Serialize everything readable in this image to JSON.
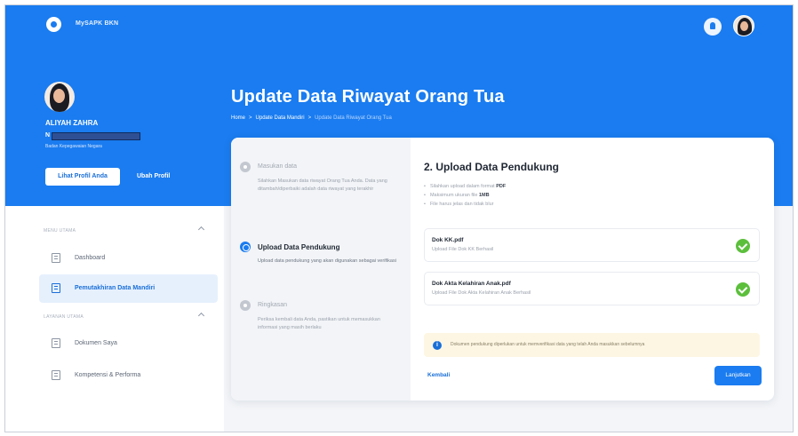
{
  "app": {
    "name": "MySAPK BKN"
  },
  "user": {
    "name": "ALIYAH ZAHRA",
    "nip_prefix": "N",
    "unit": "Badan Kepegawaian Negara",
    "view_profile_label": "Lihat Profil Anda",
    "edit_profile_label": "Ubah Profil"
  },
  "page": {
    "title": "Update Data Riwayat Orang Tua",
    "breadcrumb": [
      "Home",
      "Update Data Mandiri",
      "Update Data Riwayat Orang Tua"
    ]
  },
  "sidebar": {
    "sections": [
      {
        "label": "MENU UTAMA",
        "items": [
          "Dashboard",
          "Pemutakhiran Data Mandiri"
        ]
      },
      {
        "label": "LAYANAN UTAMA",
        "items": [
          "Dokumen Saya",
          "Kompetensi & Performa"
        ]
      }
    ],
    "active_item": "Pemutakhiran Data Mandiri"
  },
  "steps": [
    {
      "title": "Masukan data",
      "description": "Silahkan Masukan data riwayat Orang Tua Anda. Data yang ditambah/diperbaiki adalah data riwayat yang terakhir",
      "state": "done"
    },
    {
      "title": "Upload Data Pendukung",
      "description": "Upload data pendukung yang akan digunakan sebagai verifikasi",
      "state": "active"
    },
    {
      "title": "Ringkasan",
      "description": "Periksa kembali data Anda, pastikan untuk memasukkan informasi yang masih berlaku",
      "state": "pending"
    }
  ],
  "upload": {
    "title": "2. Upload Data Pendukung",
    "requirements": [
      {
        "text": "Silahkan upload dalam format ",
        "bold": "PDF"
      },
      {
        "text": "Maksimum ukuran file ",
        "bold": "1MB"
      },
      {
        "text": "File harus jelas dan tidak blur",
        "bold": ""
      }
    ],
    "files": [
      {
        "name": "Dok KK.pdf",
        "status": "Upload File Dok KK Berhasil"
      },
      {
        "name": "Dok Akta Kelahiran Anak.pdf",
        "status": "Upload File Dok Akta Kelahiran Anak Berhasil"
      }
    ],
    "notice": "Dokumen pendukung diperlukan untuk memverifikasi data yang telah Anda masukkan sebelumnya",
    "back_label": "Kembali",
    "next_label": "Lanjutkan"
  },
  "colors": {
    "brand": "#1a7cf0",
    "success": "#5cbf3c",
    "notice_bg": "#fdf6e3"
  }
}
